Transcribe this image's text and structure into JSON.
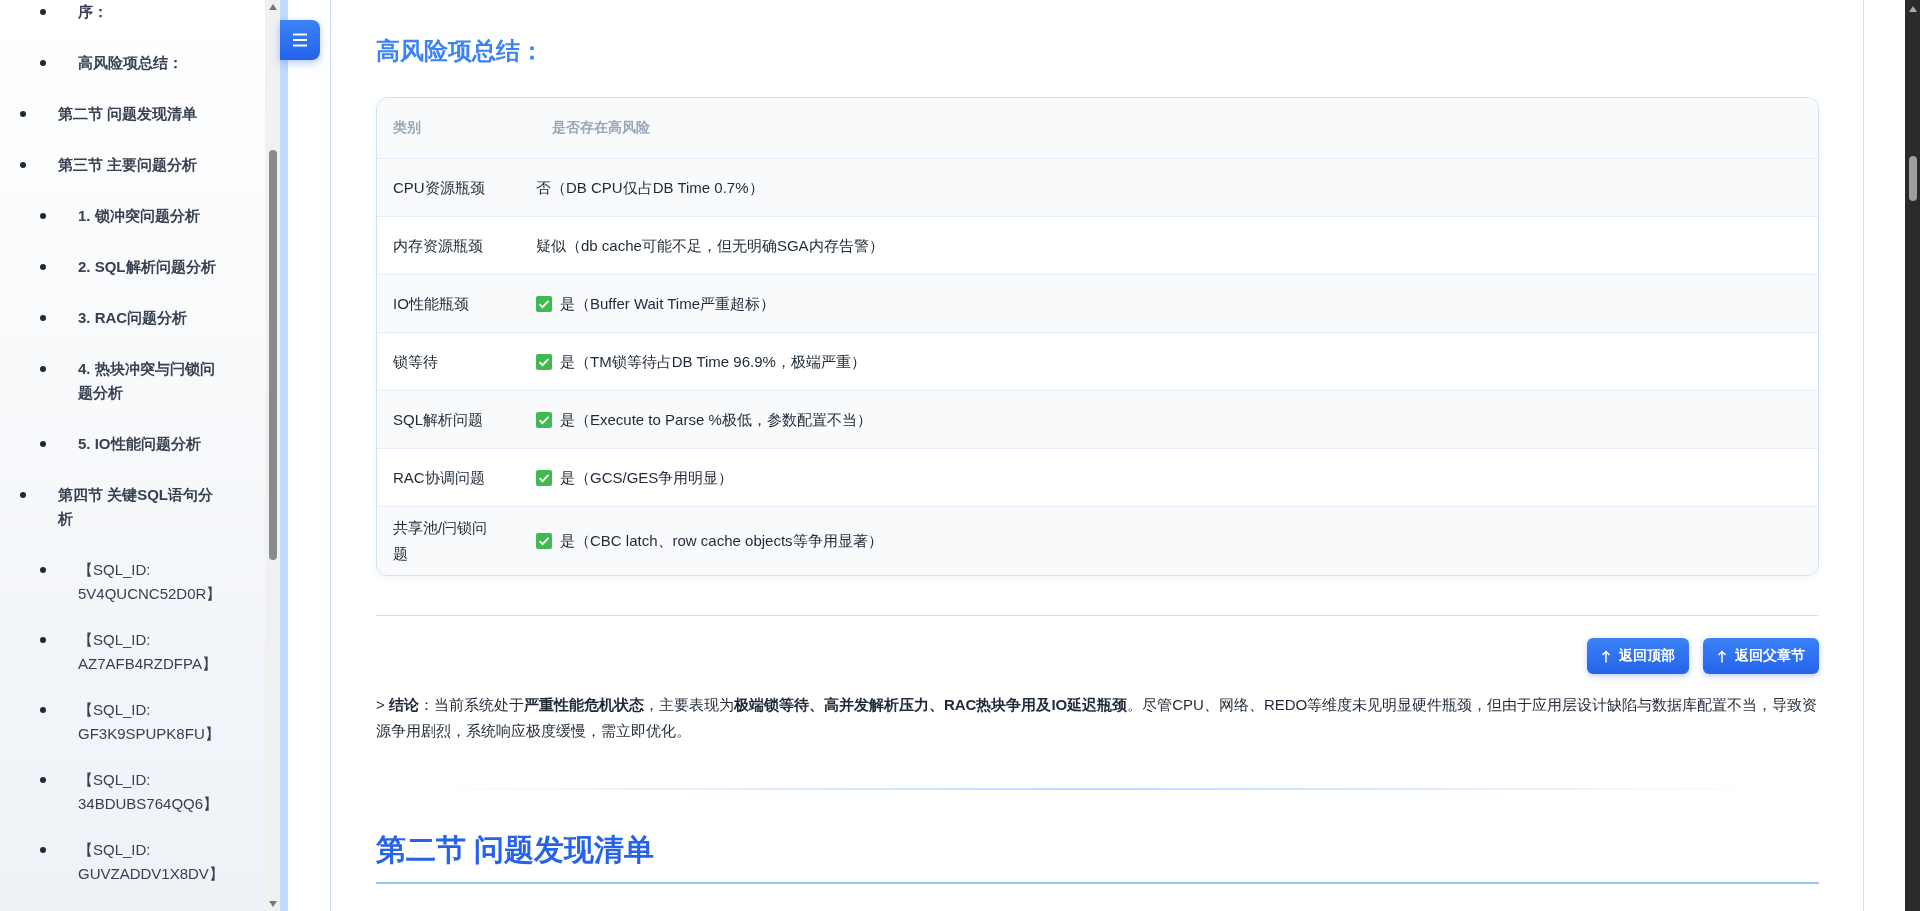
{
  "sidebar": {
    "items": [
      {
        "children": [
          {
            "label": "序："
          },
          {
            "label": "高风险项总结："
          }
        ]
      },
      {
        "label": "第二节 问题发现清单"
      },
      {
        "label": "第三节 主要问题分析",
        "children": [
          {
            "label": "1. 锁冲突问题分析"
          },
          {
            "label": "2. SQL解析问题分析"
          },
          {
            "label": "3. RAC问题分析"
          },
          {
            "label": "4. 热块冲突与闩锁问题分析"
          },
          {
            "label": "5. IO性能问题分析"
          }
        ]
      },
      {
        "label": "第四节 关键SQL语句分析",
        "children": [
          {
            "label": "【SQL_ID: 5V4QUCNC52D0R】"
          },
          {
            "label": "【SQL_ID: AZ7AFB4RZDFPA】"
          },
          {
            "label": "【SQL_ID: GF3K9SPUPK8FU】"
          },
          {
            "label": "【SQL_ID: 34BDUBS764QQ6】"
          },
          {
            "label": "【SQL_ID: GUVZADDV1X8DV】"
          }
        ]
      }
    ]
  },
  "section": {
    "heading": "高风险项总结：",
    "table": {
      "columns": [
        "类别",
        "是否存在高风险"
      ],
      "rows": [
        {
          "category": "CPU资源瓶颈",
          "checked": false,
          "status": "否（DB CPU仅占DB Time 0.7%）"
        },
        {
          "category": "内存资源瓶颈",
          "checked": false,
          "status": "疑似（db cache可能不足，但无明确SGA内存告警）"
        },
        {
          "category": "IO性能瓶颈",
          "checked": true,
          "status": "是（Buffer Wait Time严重超标）"
        },
        {
          "category": "锁等待",
          "checked": true,
          "status": "是（TM锁等待占DB Time 96.9%，极端严重）"
        },
        {
          "category": "SQL解析问题",
          "checked": true,
          "status": "是（Execute to Parse %极低，参数配置不当）"
        },
        {
          "category": "RAC协调问题",
          "checked": true,
          "status": "是（GCS/GES争用明显）"
        },
        {
          "category": "共享池/闩锁问题",
          "checked": true,
          "status": "是（CBC latch、row cache objects等争用显著）"
        }
      ]
    },
    "buttons": [
      "返回顶部",
      "返回父章节"
    ],
    "conclusion": "> **结论**：当前系统处于**严重性能危机状态**，主要表现为**极端锁等待、高并发解析压力、RAC热块争用及IO延迟瓶颈**。尽管CPU、网络、REDO等维度未见明显硬件瓶颈，但由于应用层设计缺陷与数据库配置不当，导致资源争用剧烈，系统响应极度缓慢，需立即优化。"
  },
  "next_section": {
    "heading": "第二节 问题发现清单"
  }
}
